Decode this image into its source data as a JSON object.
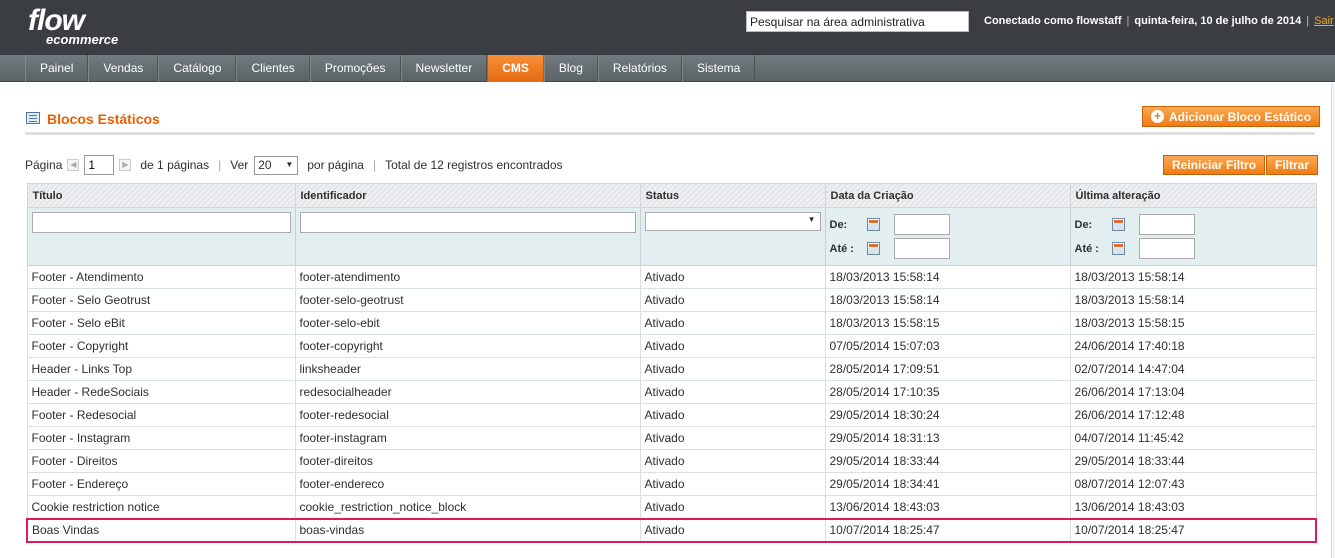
{
  "header": {
    "logo_main": "flow",
    "logo_sub": "ecommerce",
    "search_placeholder": "Pesquisar na área administrativa",
    "logged_in": "Conectado como flowstaff",
    "date": "quinta-feira, 10 de julho de 2014",
    "logout": "Sair"
  },
  "nav": {
    "items": [
      "Painel",
      "Vendas",
      "Catálogo",
      "Clientes",
      "Promoções",
      "Newsletter",
      "CMS",
      "Blog",
      "Relatórios",
      "Sistema"
    ],
    "active": "CMS"
  },
  "page": {
    "title": "Blocos Estáticos",
    "add_button": "Adicionar Bloco Estático"
  },
  "pager": {
    "page_label": "Página",
    "page_value": "1",
    "of_pages": "de 1 páginas",
    "view_label": "Ver",
    "per_page_value": "20",
    "per_page_label": "por página",
    "total": "Total de 12 registros encontrados",
    "reset_button": "Reiniciar Filtro",
    "filter_button": "Filtrar"
  },
  "grid": {
    "columns": [
      "Título",
      "Identificador",
      "Status",
      "Data da Criação",
      "Última alteração"
    ],
    "date_from_label": "De:",
    "date_to_label": "Até :",
    "rows": [
      [
        "Footer - Atendimento",
        "footer-atendimento",
        "Ativado",
        "18/03/2013 15:58:14",
        "18/03/2013 15:58:14"
      ],
      [
        "Footer - Selo Geotrust",
        "footer-selo-geotrust",
        "Ativado",
        "18/03/2013 15:58:14",
        "18/03/2013 15:58:14"
      ],
      [
        "Footer - Selo eBit",
        "footer-selo-ebit",
        "Ativado",
        "18/03/2013 15:58:15",
        "18/03/2013 15:58:15"
      ],
      [
        "Footer - Copyright",
        "footer-copyright",
        "Ativado",
        "07/05/2014 15:07:03",
        "24/06/2014 17:40:18"
      ],
      [
        "Header - Links Top",
        "linksheader",
        "Ativado",
        "28/05/2014 17:09:51",
        "02/07/2014 14:47:04"
      ],
      [
        "Header - RedeSociais",
        "redesocialheader",
        "Ativado",
        "28/05/2014 17:10:35",
        "26/06/2014 17:13:04"
      ],
      [
        "Footer - Redesocial",
        "footer-redesocial",
        "Ativado",
        "29/05/2014 18:30:24",
        "26/06/2014 17:12:48"
      ],
      [
        "Footer - Instagram",
        "footer-instagram",
        "Ativado",
        "29/05/2014 18:31:13",
        "04/07/2014 11:45:42"
      ],
      [
        "Footer - Direitos",
        "footer-direitos",
        "Ativado",
        "29/05/2014 18:33:44",
        "29/05/2014 18:33:44"
      ],
      [
        "Footer - Endereço",
        "footer-endereco",
        "Ativado",
        "29/05/2014 18:34:41",
        "08/07/2014 12:07:43"
      ],
      [
        "Cookie restriction notice",
        "cookie_restriction_notice_block",
        "Ativado",
        "13/06/2014 18:43:03",
        "13/06/2014 18:43:03"
      ],
      [
        "Boas Vindas",
        "boas-vindas",
        "Ativado",
        "10/07/2014 18:25:47",
        "10/07/2014 18:25:47"
      ]
    ],
    "highlighted_row": 11
  },
  "colors": {
    "header_bg": "#3a3e42",
    "accent_orange": "#eb5e00",
    "highlight_border": "#e0185d"
  }
}
